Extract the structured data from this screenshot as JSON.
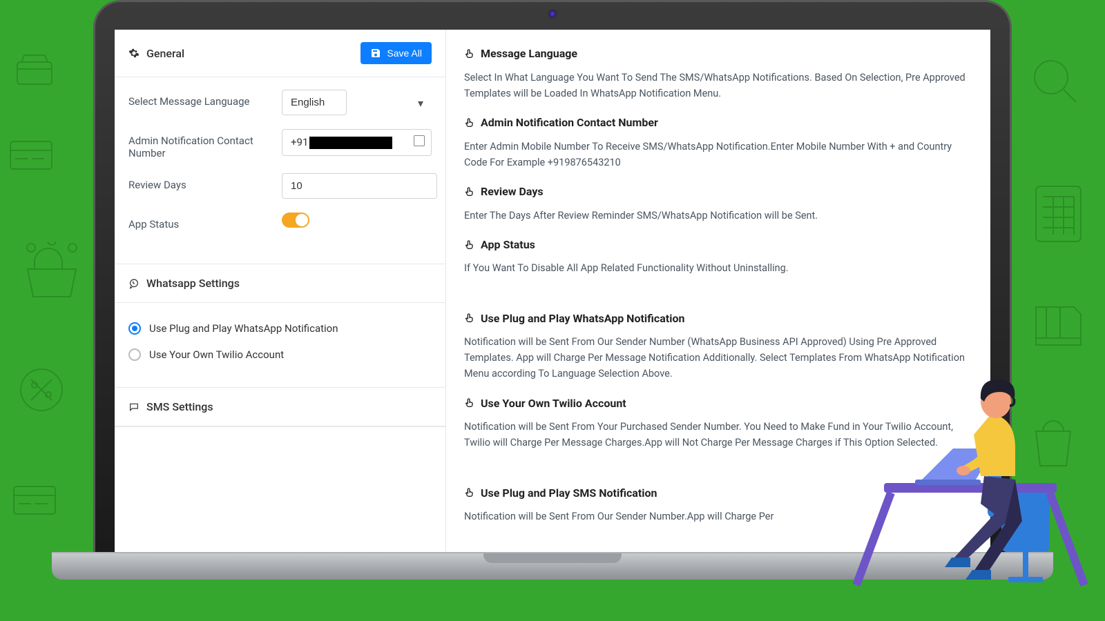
{
  "general": {
    "title": "General",
    "save_button": "Save All",
    "language_label": "Select Message Language",
    "language_value": "English",
    "admin_contact_label": "Admin Notification Contact Number",
    "admin_contact_prefix": "+91",
    "review_days_label": "Review Days",
    "review_days_value": "10",
    "app_status_label": "App Status",
    "app_status_on": true
  },
  "whatsapp": {
    "title": "Whatsapp Settings",
    "option_plug": "Use Plug and Play WhatsApp Notification",
    "option_twilio": "Use Your Own Twilio Account",
    "selected": "plug"
  },
  "sms": {
    "title": "SMS Settings"
  },
  "help": {
    "msg_lang_h": "Message Language",
    "msg_lang_p": "Select In What Language You Want To Send The SMS/WhatsApp Notifications. Based On Selection, Pre Approved Templates will be Loaded In WhatsApp Notification Menu.",
    "admin_h": "Admin Notification Contact Number",
    "admin_p": "Enter Admin Mobile Number To Receive SMS/WhatsApp Notification.Enter Mobile Number With + and Country Code For Example +919876543210",
    "review_h": "Review Days",
    "review_p": "Enter The Days After Review Reminder SMS/WhatsApp Notification will be Sent.",
    "status_h": "App Status",
    "status_p": "If You Want To Disable All App Related Functionality Without Uninstalling.",
    "wa_plug_h": "Use Plug and Play WhatsApp Notification",
    "wa_plug_p": "Notification will be Sent From Our Sender Number (WhatsApp Business API Approved) Using Pre Approved Templates. App will Charge Per Message Notification Additionally. Select Templates From WhatsApp Notification Menu according To Language Selection Above.",
    "wa_twilio_h": "Use Your Own Twilio Account",
    "wa_twilio_p": "Notification will be Sent From Your Purchased Sender Number. You Need to Make Fund in Your Twilio Account, Twilio will Charge Per Message Charges.App will Not Charge Per Message Charges if This Option Selected.",
    "sms_plug_h": "Use Plug and Play SMS Notification",
    "sms_plug_p": "Notification will be Sent From Our Sender Number.App will Charge Per"
  }
}
